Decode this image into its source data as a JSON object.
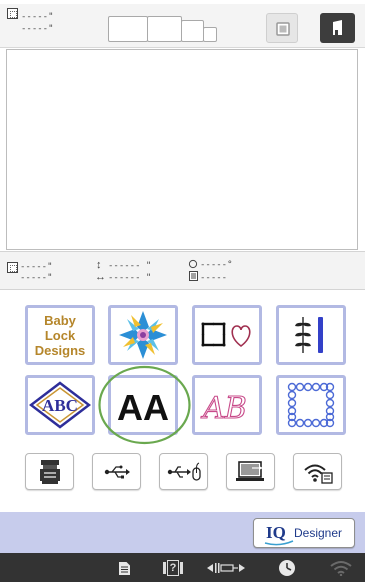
{
  "top_bar": {
    "design_size_width": "-----\"",
    "design_size_height": "-----\"",
    "home_icon": "home-icon",
    "frame_icon": "embroidery-frame-icon"
  },
  "info_strip": {
    "position_x": "-----\"",
    "position_y": "-----\"",
    "height_value": "------ \"",
    "width_value": "------ \"",
    "rotation_value": "-----°",
    "stitch_count": "-----"
  },
  "categories": [
    {
      "label_line1": "Baby Lock",
      "label_line2": "Designs",
      "color": "#b5862b"
    },
    {
      "icon": "quilt-pattern-icon"
    },
    {
      "icon": "frame-heart-icon"
    },
    {
      "icon": "utility-stitch-icon"
    },
    {
      "icon": "monogram-icon",
      "text": "ABC"
    },
    {
      "icon": "character-font-icon",
      "text": "AA"
    },
    {
      "icon": "decorative-alphabet-icon",
      "text": "AB"
    },
    {
      "icon": "frame-pattern-icon"
    }
  ],
  "devices": [
    {
      "icon": "machine-memory-icon"
    },
    {
      "icon": "usb-icon"
    },
    {
      "icon": "usb-mouse-icon"
    },
    {
      "icon": "computer-icon"
    },
    {
      "icon": "wireless-icon"
    }
  ],
  "iq_designer": {
    "iq": "IQ",
    "designer": "Designer"
  },
  "status_bar": {
    "icons": [
      "document-icon",
      "help-icon",
      "thread-tension-icon",
      "clock-icon",
      "wifi-icon"
    ],
    "help_text": "?"
  },
  "colors": {
    "accent_border": "#b2b9e3",
    "band": "#c7ccec",
    "status_bar": "#333333",
    "highlight_circle": "#6aa84f",
    "iq_blue": "#1f3a8a"
  }
}
